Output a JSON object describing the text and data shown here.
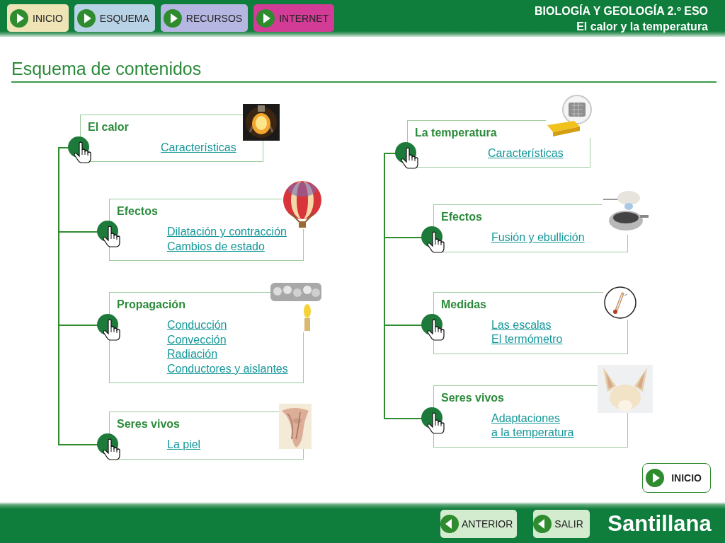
{
  "header": {
    "nav": [
      {
        "label": "INICIO",
        "color": "#eee4b6"
      },
      {
        "label": "ESQUEMA",
        "color": "#b9d3e6"
      },
      {
        "label": "RECURSOS",
        "color": "#b6b6e2"
      },
      {
        "label": "INTERNET",
        "color": "#d23c97"
      }
    ],
    "subject": "BIOLOGÍA Y GEOLOGÍA 2.º ESO",
    "topic": "El calor y la temperatura"
  },
  "page_title": "Esquema de contenidos",
  "columns": [
    {
      "cards": [
        {
          "title": "El calor",
          "links": [
            "Características"
          ],
          "picture": {
            "kind": "picture"
          }
        },
        {
          "title": "Efectos",
          "links": [
            "Dilatación y contracción",
            "Cambios de estado"
          ],
          "picture": {
            "kind": "picture"
          }
        },
        {
          "title": "Propagación",
          "links": [
            "Conducción",
            "Convección",
            "Radiación",
            "Conductores y aislantes"
          ],
          "picture": {
            "kind": "picture"
          }
        },
        {
          "title": "Seres vivos",
          "links": [
            "La piel"
          ],
          "picture": {
            "kind": "picture"
          }
        }
      ]
    },
    {
      "cards": [
        {
          "title": "La temperatura",
          "links": [
            "Características"
          ],
          "picture": {
            "kind": "picture"
          }
        },
        {
          "title": "Efectos",
          "links": [
            "Fusión y ebullición"
          ],
          "picture": {
            "kind": "picture"
          }
        },
        {
          "title": "Medidas",
          "links": [
            "Las escalas",
            "El termómetro"
          ],
          "picture": {
            "kind": "picture"
          }
        },
        {
          "title": "Seres vivos",
          "links": [
            "Adaptaciones",
            "a la temperatura"
          ],
          "picture": {
            "kind": "picture"
          }
        }
      ]
    }
  ],
  "home_button": "INICIO",
  "footer": {
    "buttons": [
      "ANTERIOR",
      "SALIR"
    ],
    "brand": "Santillana"
  }
}
